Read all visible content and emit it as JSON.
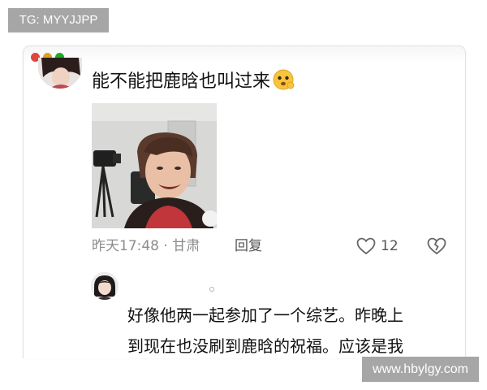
{
  "watermarks": {
    "top_left": "TG: MYYJJPP",
    "bottom_right": "www.hbylgy.com"
  },
  "window": {
    "controls": [
      "close",
      "minimize",
      "maximize"
    ],
    "colors": {
      "close": "#e0443e",
      "minimize": "#dea123",
      "maximize": "#1aab29"
    }
  },
  "comment": {
    "text": "能不能把鹿晗也叫过来",
    "emoji": "thinking-face-emoji",
    "time_location": "昨天17:48 · 甘肃",
    "reply_label": "回复",
    "like_count": "12",
    "icons": [
      "heart-outline-icon",
      "broken-heart-icon"
    ]
  },
  "reply": {
    "lines": [
      "好像他两一起参加了一个综艺。昨晚上",
      "到现在也没刷到鹿晗的祝福。应该是我"
    ]
  }
}
